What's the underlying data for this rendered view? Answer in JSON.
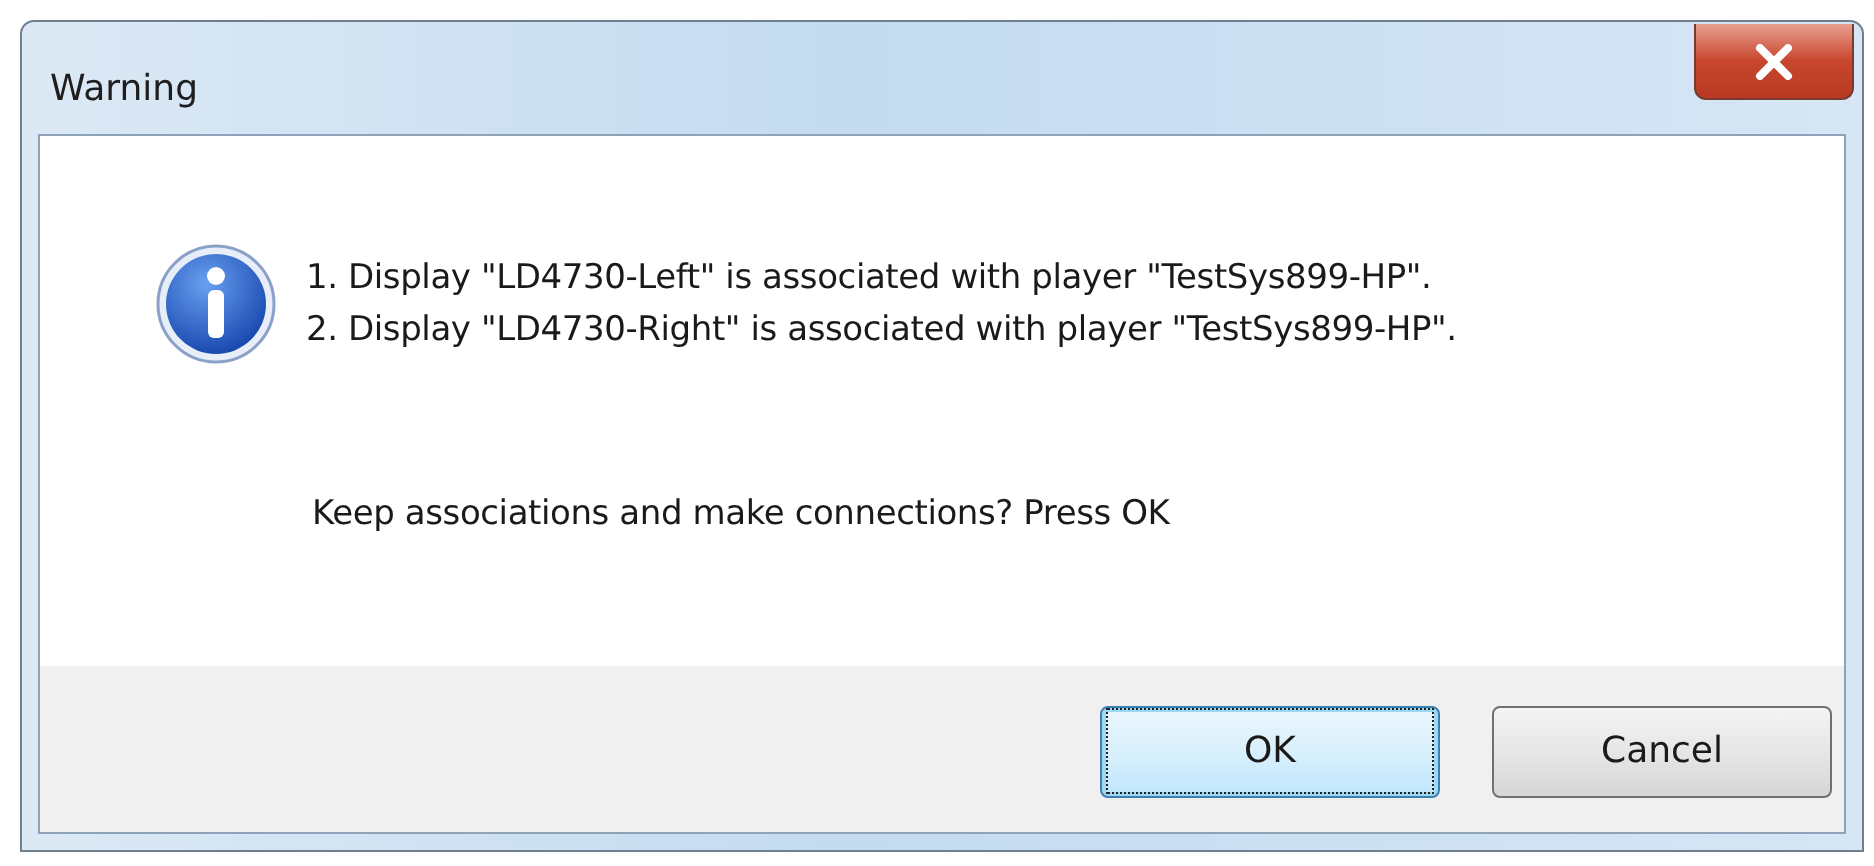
{
  "window": {
    "title": "Warning"
  },
  "messages": [
    "1. Display \"LD4730-Left\" is associated with player \"TestSys899-HP\".",
    "2. Display \"LD4730-Right\" is associated with player \"TestSys899-HP\"."
  ],
  "prompt": "Keep associations and make connections? Press OK",
  "buttons": [
    {
      "label": "OK",
      "focused": true
    },
    {
      "label": "Cancel",
      "focused": false
    }
  ]
}
